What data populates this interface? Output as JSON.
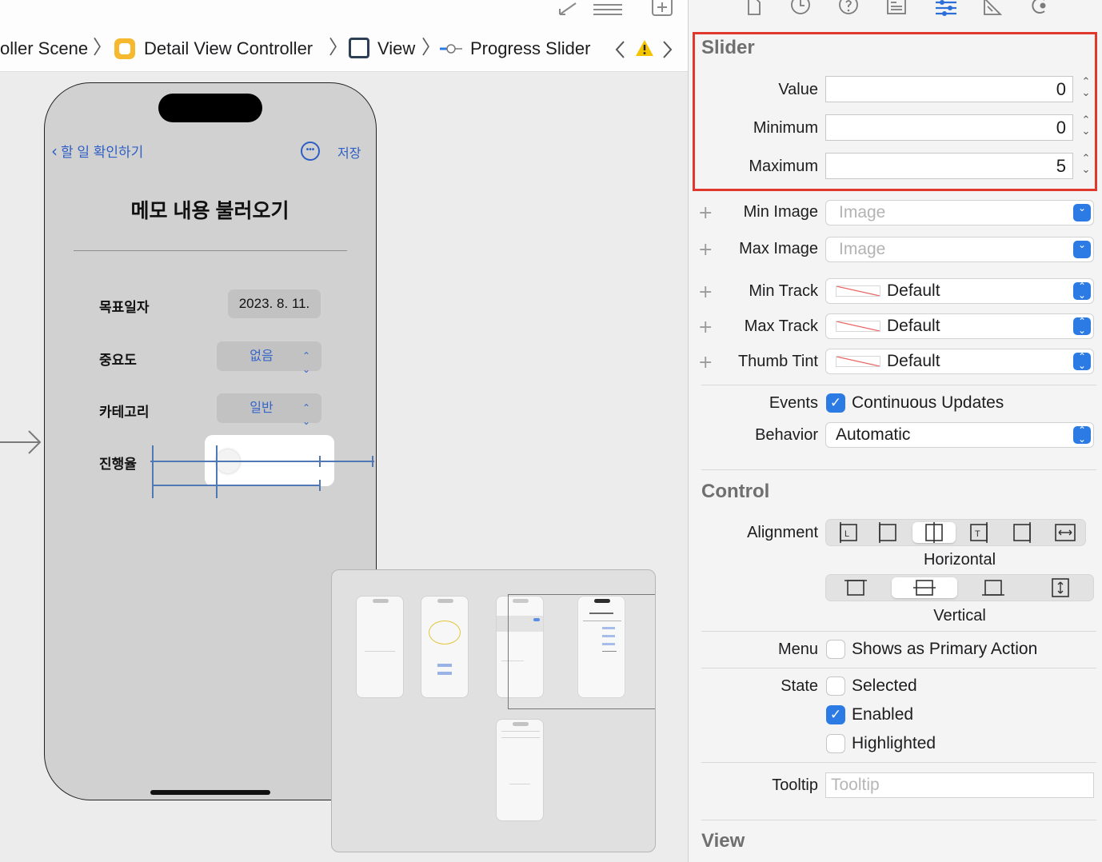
{
  "jump_bar": {
    "crumbs": [
      "oller Scene",
      "Detail View Controller",
      "View",
      "Progress Slider"
    ],
    "separator": "〉"
  },
  "phone": {
    "nav": {
      "back_label": "할 일 확인하기",
      "save_label": "저장"
    },
    "title": "메모 내용 불러오기",
    "rows": [
      {
        "label": "목표일자",
        "value": "2023. 8. 11."
      },
      {
        "label": "중요도",
        "value": "없음"
      },
      {
        "label": "카테고리",
        "value": "일반"
      },
      {
        "label": "진행율"
      }
    ]
  },
  "inspector": {
    "slider": {
      "title": "Slider",
      "value_label": "Value",
      "value": "0",
      "minimum_label": "Minimum",
      "minimum": "0",
      "maximum_label": "Maximum",
      "maximum": "5",
      "min_image_label": "Min Image",
      "min_image_placeholder": "Image",
      "max_image_label": "Max Image",
      "max_image_placeholder": "Image",
      "min_track_label": "Min Track",
      "min_track": "Default",
      "max_track_label": "Max Track",
      "max_track": "Default",
      "thumb_tint_label": "Thumb Tint",
      "thumb_tint": "Default",
      "events_label": "Events",
      "continuous_updates": "Continuous Updates",
      "continuous_updates_checked": true,
      "behavior_label": "Behavior",
      "behavior": "Automatic"
    },
    "control": {
      "title": "Control",
      "alignment_label": "Alignment",
      "horizontal_caption": "Horizontal",
      "vertical_caption": "Vertical",
      "menu_label": "Menu",
      "menu_option": "Shows as Primary Action",
      "state_label": "State",
      "states": [
        {
          "label": "Selected",
          "checked": false
        },
        {
          "label": "Enabled",
          "checked": true
        },
        {
          "label": "Highlighted",
          "checked": false
        }
      ],
      "tooltip_label": "Tooltip",
      "tooltip_placeholder": "Tooltip"
    },
    "view": {
      "title": "View"
    }
  },
  "colors": {
    "accent": "#2c7be5",
    "highlight_border": "#e0382d",
    "ios_link": "#2f5fc4",
    "warning": "#f5c400"
  }
}
